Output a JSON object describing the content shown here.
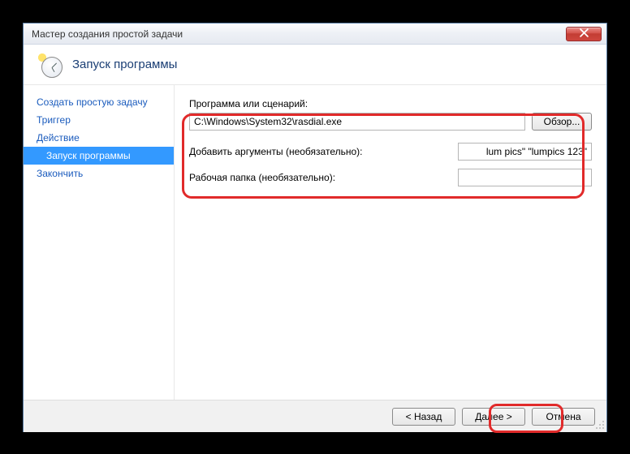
{
  "window": {
    "title": "Мастер создания простой задачи",
    "heading": "Запуск программы"
  },
  "sidebar": {
    "items": [
      {
        "label": "Создать простую задачу",
        "name": "step-create"
      },
      {
        "label": "Триггер",
        "name": "step-trigger"
      },
      {
        "label": "Действие",
        "name": "step-action"
      },
      {
        "label": "Запуск программы",
        "name": "step-start-program",
        "sub": true
      },
      {
        "label": "Закончить",
        "name": "step-finish"
      }
    ]
  },
  "form": {
    "program_label": "Программа или сценарий:",
    "program_value": "C:\\Windows\\System32\\rasdial.exe",
    "browse_label": "Обзор...",
    "args_label": "Добавить аргументы (необязательно):",
    "args_value": "lum pics\" \"lumpics 123\"",
    "startin_label": "Рабочая папка (необязательно):",
    "startin_value": ""
  },
  "footer": {
    "back": "< Назад",
    "next": "Далее >",
    "cancel": "Отмена"
  }
}
